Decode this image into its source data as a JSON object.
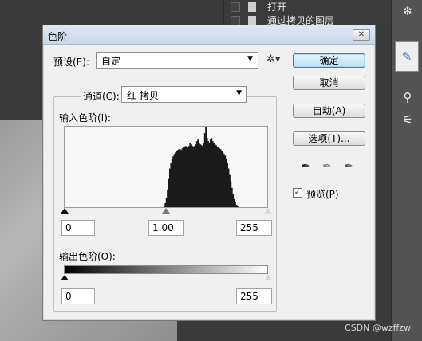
{
  "background": {
    "layers_panel": {
      "rows": [
        {
          "label": "打开"
        },
        {
          "label": "通过拷贝的图层"
        }
      ]
    },
    "watermark": "CSDN @wzffzw"
  },
  "dialog": {
    "title": "色阶",
    "close_glyph": "✕",
    "preset": {
      "label": "预设(E):",
      "value": "自定"
    },
    "channel": {
      "label": "通道(C):",
      "value": "红 拷贝"
    },
    "input_levels": {
      "label": "输入色阶(I):",
      "black": "0",
      "gamma": "1.00",
      "white": "255"
    },
    "output_levels": {
      "label": "输出色阶(O):",
      "black": "0",
      "white": "255"
    },
    "buttons": {
      "ok": "确定",
      "cancel": "取消",
      "auto": "自动(A)",
      "options": "选项(T)..."
    },
    "preview": {
      "label": "预览(P)",
      "checked": true
    }
  },
  "histogram_data": {
    "bins_start": 123,
    "bins_end": 218,
    "description_values": [
      0,
      2,
      5,
      12,
      22,
      35,
      48,
      55,
      60,
      63,
      66,
      68,
      70,
      71,
      72,
      72,
      71,
      73,
      74,
      75,
      76,
      75,
      74,
      76,
      80,
      78,
      76,
      75,
      76,
      78,
      82,
      84,
      80,
      78,
      77,
      76,
      80,
      92,
      100,
      86,
      82,
      80,
      84,
      86,
      82,
      80,
      78,
      77,
      75,
      74,
      73,
      72,
      70,
      68,
      66,
      64,
      60,
      55,
      48,
      40,
      32,
      24,
      16,
      10,
      6,
      3,
      1,
      0
    ]
  }
}
